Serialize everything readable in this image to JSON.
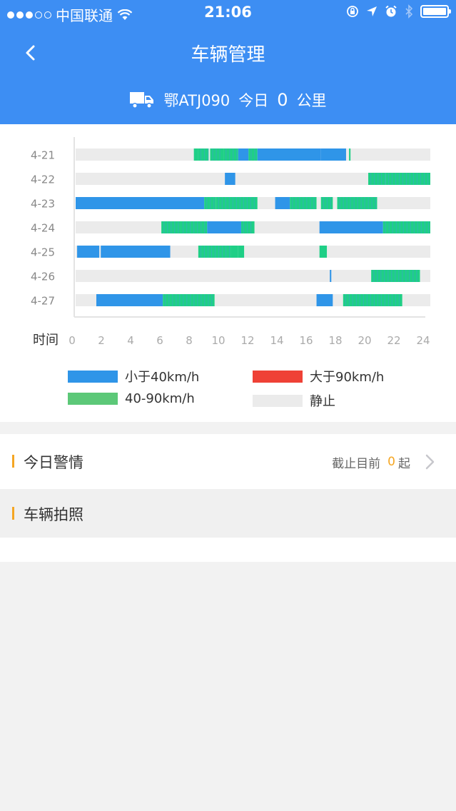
{
  "status_bar": {
    "carrier": "中国联通",
    "time": "21:06"
  },
  "nav": {
    "title": "车辆管理"
  },
  "vehicle": {
    "plate": "鄂ATJ090",
    "today_label": "今日",
    "distance": "0",
    "unit": "公里"
  },
  "chart_data": {
    "type": "bar",
    "title": "",
    "xlabel": "时间",
    "ylabel": "",
    "x_ticks": [
      "0",
      "2",
      "4",
      "6",
      "8",
      "10",
      "12",
      "14",
      "16",
      "18",
      "20",
      "22",
      "24"
    ],
    "xlim": [
      0,
      24
    ],
    "categories": [
      "4-21",
      "4-22",
      "4-23",
      "4-24",
      "4-25",
      "4-26",
      "4-27"
    ],
    "legend": [
      {
        "label": "小于40km/h",
        "color": "#2f95e8"
      },
      {
        "label": "大于90km/h",
        "color": "#ef4136"
      },
      {
        "label": "40-90km/h",
        "color": "#5cc878"
      },
      {
        "label": "静止",
        "color": "#ebebeb"
      }
    ],
    "colors": {
      "slow": "#2f95e8",
      "medium": "#1fcf86",
      "fast": "#ef4136",
      "stopped": "#ebebeb"
    },
    "rows": [
      {
        "date": "4-21",
        "segments": [
          {
            "start": 8.0,
            "end": 8.3,
            "speed": "medium"
          },
          {
            "start": 8.3,
            "end": 9.0,
            "speed": "medium"
          },
          {
            "start": 9.1,
            "end": 10.0,
            "speed": "medium"
          },
          {
            "start": 10.0,
            "end": 11.0,
            "speed": "medium"
          },
          {
            "start": 11.0,
            "end": 11.7,
            "speed": "slow"
          },
          {
            "start": 11.7,
            "end": 12.3,
            "speed": "medium"
          },
          {
            "start": 12.3,
            "end": 16.6,
            "speed": "slow"
          },
          {
            "start": 16.6,
            "end": 18.3,
            "speed": "slow"
          },
          {
            "start": 18.5,
            "end": 18.6,
            "speed": "medium"
          }
        ]
      },
      {
        "date": "4-22",
        "segments": [
          {
            "start": 10.1,
            "end": 10.8,
            "speed": "slow"
          },
          {
            "start": 19.8,
            "end": 21.0,
            "speed": "medium"
          },
          {
            "start": 21.0,
            "end": 24.0,
            "speed": "medium"
          }
        ]
      },
      {
        "date": "4-23",
        "segments": [
          {
            "start": 0.0,
            "end": 8.7,
            "speed": "slow"
          },
          {
            "start": 8.7,
            "end": 9.5,
            "speed": "medium"
          },
          {
            "start": 9.5,
            "end": 12.3,
            "speed": "medium"
          },
          {
            "start": 13.5,
            "end": 14.5,
            "speed": "slow"
          },
          {
            "start": 14.5,
            "end": 16.3,
            "speed": "medium"
          },
          {
            "start": 16.6,
            "end": 17.4,
            "speed": "medium"
          },
          {
            "start": 17.7,
            "end": 20.4,
            "speed": "medium"
          }
        ]
      },
      {
        "date": "4-24",
        "segments": [
          {
            "start": 5.8,
            "end": 7.1,
            "speed": "medium"
          },
          {
            "start": 7.1,
            "end": 8.9,
            "speed": "medium"
          },
          {
            "start": 8.9,
            "end": 11.2,
            "speed": "slow"
          },
          {
            "start": 11.2,
            "end": 12.1,
            "speed": "medium"
          },
          {
            "start": 16.5,
            "end": 20.8,
            "speed": "slow"
          },
          {
            "start": 20.8,
            "end": 24.0,
            "speed": "medium"
          }
        ]
      },
      {
        "date": "4-25",
        "segments": [
          {
            "start": 0.1,
            "end": 1.6,
            "speed": "slow"
          },
          {
            "start": 1.7,
            "end": 6.4,
            "speed": "slow"
          },
          {
            "start": 8.3,
            "end": 10.5,
            "speed": "medium"
          },
          {
            "start": 10.5,
            "end": 11.0,
            "speed": "medium"
          },
          {
            "start": 11.0,
            "end": 11.4,
            "speed": "medium"
          },
          {
            "start": 16.5,
            "end": 17.0,
            "speed": "medium"
          }
        ]
      },
      {
        "date": "4-26",
        "segments": [
          {
            "start": 17.2,
            "end": 17.3,
            "speed": "slow"
          },
          {
            "start": 20.0,
            "end": 23.3,
            "speed": "medium"
          }
        ]
      },
      {
        "date": "4-27",
        "segments": [
          {
            "start": 1.4,
            "end": 5.9,
            "speed": "slow"
          },
          {
            "start": 5.9,
            "end": 9.4,
            "speed": "medium"
          },
          {
            "start": 16.3,
            "end": 17.4,
            "speed": "slow"
          },
          {
            "start": 18.1,
            "end": 22.1,
            "speed": "medium"
          }
        ]
      }
    ]
  },
  "alert": {
    "title": "今日警情",
    "prefix": "截止目前",
    "count": "0",
    "suffix": "起"
  },
  "photos": {
    "title": "车辆拍照"
  }
}
